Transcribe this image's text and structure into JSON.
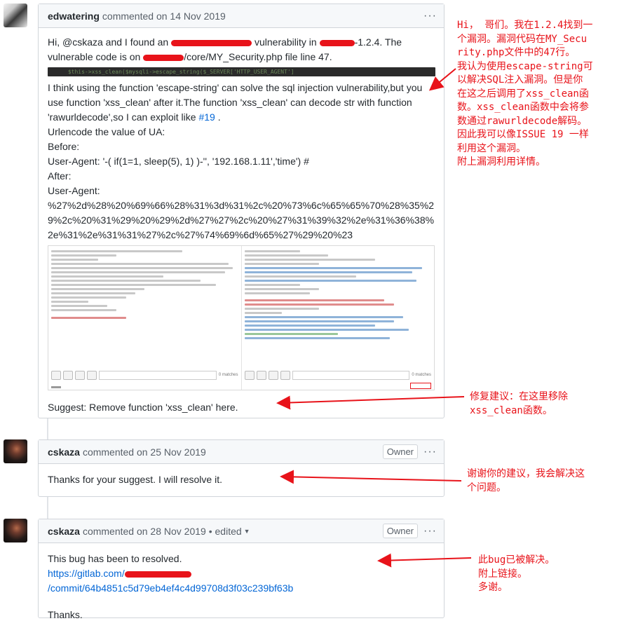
{
  "comments": [
    {
      "author": "edwatering",
      "meta": "commented on 14 Nov 2019",
      "menu": "···",
      "text": {
        "l1a": "Hi, @cskaza and I found an ",
        "l1b": " vulnerability in ",
        "l1c": "-1.2.4. The",
        "l2a": "vulnerable code is on ",
        "l2b": "/core/MY_Security.php file line 47.",
        "code": "$this->xss_clean($mysqli->escape_string($_SERVER['HTTP_USER_AGENT']",
        "p1": "I think using the function 'escape-string' can solve the sql injection vulnerability,but you use function 'xss_clean' after it.The function 'xss_clean' can decode str with function 'rawurldecode',so I can exploit like ",
        "issue_link": "#19",
        "p1_end": " .",
        "p2": "Urlencode the value of UA:",
        "p3": "Before:",
        "p4": "User-Agent: '-( if(1=1, sleep(5), 1) )-'', '192.168.1.11','time') #",
        "p5": "After:",
        "p6": "User-Agent:",
        "p7": "%27%2d%28%20%69%66%28%31%3d%31%2c%20%73%6c%65%65%70%28%35%29%2c%20%31%29%20%29%2d%27%27%2c%20%27%31%39%32%2e%31%36%38%2e%31%2e%31%31%27%2c%27%74%69%6d%65%27%29%20%23",
        "burp_matches_left": "0 matches",
        "burp_matches_right": "0 matches",
        "suggest": "Suggest: Remove function 'xss_clean' here."
      }
    },
    {
      "author": "cskaza",
      "meta": "commented on 25 Nov 2019",
      "badge": "Owner",
      "menu": "···",
      "text": {
        "p1": "Thanks for your suggest. I will resolve it."
      }
    },
    {
      "author": "cskaza",
      "meta": "commented on 28 Nov 2019 • edited",
      "badge": "Owner",
      "menu": "···",
      "text": {
        "p1": "This bug has been to resolved.",
        "link_a": "https://gitlab.com/",
        "link_b": "/commit/64b4851c5d79eb4ef4c4d99708d3f03c239bf63b",
        "p2": "Thanks."
      }
    }
  ],
  "notes": {
    "n1": [
      "Hi， 哥们。我在1.2.4找到一",
      "个漏洞。漏洞代码在MY_Secu",
      "rity.php文件中的47行。",
      "我认为使用escape-string可",
      "以解决SQL注入漏洞。但是你",
      "在这之后调用了xss_clean函",
      "数。xss_clean函数中会将参",
      "数通过rawurldecode解码。",
      "因此我可以像ISSUE 19 一样",
      "利用这个漏洞。",
      "附上漏洞利用详情。"
    ],
    "n2": [
      "修复建议：在这里移除",
      "xss_clean函数。"
    ],
    "n3": [
      "谢谢你的建议，我会解决这",
      "个问题。"
    ],
    "n4": [
      "此bug已被解决。",
      "附上链接。",
      "多谢。"
    ]
  },
  "colors": {
    "annotation": "#e8131a",
    "link": "#0366d6"
  },
  "icons": {
    "menu": "kebab-horizontal-icon",
    "caret": "triangle-down-icon"
  }
}
